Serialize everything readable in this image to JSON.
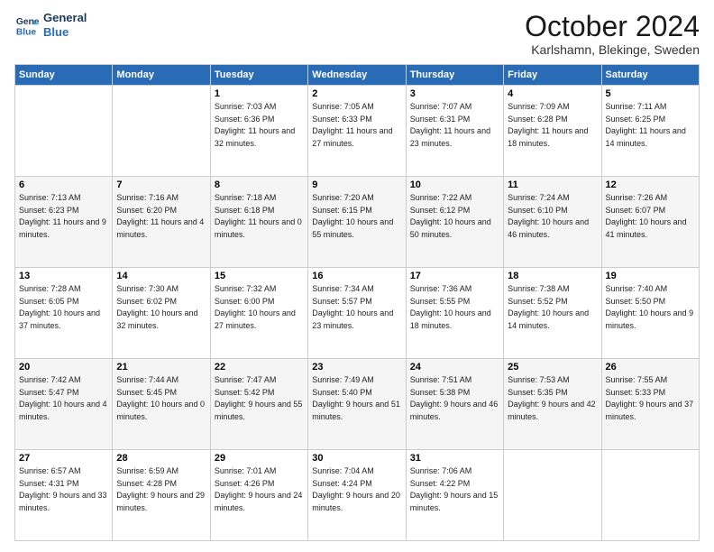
{
  "header": {
    "logo_line1": "General",
    "logo_line2": "Blue",
    "title": "October 2024",
    "subtitle": "Karlshamn, Blekinge, Sweden"
  },
  "days_of_week": [
    "Sunday",
    "Monday",
    "Tuesday",
    "Wednesday",
    "Thursday",
    "Friday",
    "Saturday"
  ],
  "weeks": [
    [
      {
        "day": "",
        "sunrise": "",
        "sunset": "",
        "daylight": ""
      },
      {
        "day": "",
        "sunrise": "",
        "sunset": "",
        "daylight": ""
      },
      {
        "day": "1",
        "sunrise": "Sunrise: 7:03 AM",
        "sunset": "Sunset: 6:36 PM",
        "daylight": "Daylight: 11 hours and 32 minutes."
      },
      {
        "day": "2",
        "sunrise": "Sunrise: 7:05 AM",
        "sunset": "Sunset: 6:33 PM",
        "daylight": "Daylight: 11 hours and 27 minutes."
      },
      {
        "day": "3",
        "sunrise": "Sunrise: 7:07 AM",
        "sunset": "Sunset: 6:31 PM",
        "daylight": "Daylight: 11 hours and 23 minutes."
      },
      {
        "day": "4",
        "sunrise": "Sunrise: 7:09 AM",
        "sunset": "Sunset: 6:28 PM",
        "daylight": "Daylight: 11 hours and 18 minutes."
      },
      {
        "day": "5",
        "sunrise": "Sunrise: 7:11 AM",
        "sunset": "Sunset: 6:25 PM",
        "daylight": "Daylight: 11 hours and 14 minutes."
      }
    ],
    [
      {
        "day": "6",
        "sunrise": "Sunrise: 7:13 AM",
        "sunset": "Sunset: 6:23 PM",
        "daylight": "Daylight: 11 hours and 9 minutes."
      },
      {
        "day": "7",
        "sunrise": "Sunrise: 7:16 AM",
        "sunset": "Sunset: 6:20 PM",
        "daylight": "Daylight: 11 hours and 4 minutes."
      },
      {
        "day": "8",
        "sunrise": "Sunrise: 7:18 AM",
        "sunset": "Sunset: 6:18 PM",
        "daylight": "Daylight: 11 hours and 0 minutes."
      },
      {
        "day": "9",
        "sunrise": "Sunrise: 7:20 AM",
        "sunset": "Sunset: 6:15 PM",
        "daylight": "Daylight: 10 hours and 55 minutes."
      },
      {
        "day": "10",
        "sunrise": "Sunrise: 7:22 AM",
        "sunset": "Sunset: 6:12 PM",
        "daylight": "Daylight: 10 hours and 50 minutes."
      },
      {
        "day": "11",
        "sunrise": "Sunrise: 7:24 AM",
        "sunset": "Sunset: 6:10 PM",
        "daylight": "Daylight: 10 hours and 46 minutes."
      },
      {
        "day": "12",
        "sunrise": "Sunrise: 7:26 AM",
        "sunset": "Sunset: 6:07 PM",
        "daylight": "Daylight: 10 hours and 41 minutes."
      }
    ],
    [
      {
        "day": "13",
        "sunrise": "Sunrise: 7:28 AM",
        "sunset": "Sunset: 6:05 PM",
        "daylight": "Daylight: 10 hours and 37 minutes."
      },
      {
        "day": "14",
        "sunrise": "Sunrise: 7:30 AM",
        "sunset": "Sunset: 6:02 PM",
        "daylight": "Daylight: 10 hours and 32 minutes."
      },
      {
        "day": "15",
        "sunrise": "Sunrise: 7:32 AM",
        "sunset": "Sunset: 6:00 PM",
        "daylight": "Daylight: 10 hours and 27 minutes."
      },
      {
        "day": "16",
        "sunrise": "Sunrise: 7:34 AM",
        "sunset": "Sunset: 5:57 PM",
        "daylight": "Daylight: 10 hours and 23 minutes."
      },
      {
        "day": "17",
        "sunrise": "Sunrise: 7:36 AM",
        "sunset": "Sunset: 5:55 PM",
        "daylight": "Daylight: 10 hours and 18 minutes."
      },
      {
        "day": "18",
        "sunrise": "Sunrise: 7:38 AM",
        "sunset": "Sunset: 5:52 PM",
        "daylight": "Daylight: 10 hours and 14 minutes."
      },
      {
        "day": "19",
        "sunrise": "Sunrise: 7:40 AM",
        "sunset": "Sunset: 5:50 PM",
        "daylight": "Daylight: 10 hours and 9 minutes."
      }
    ],
    [
      {
        "day": "20",
        "sunrise": "Sunrise: 7:42 AM",
        "sunset": "Sunset: 5:47 PM",
        "daylight": "Daylight: 10 hours and 4 minutes."
      },
      {
        "day": "21",
        "sunrise": "Sunrise: 7:44 AM",
        "sunset": "Sunset: 5:45 PM",
        "daylight": "Daylight: 10 hours and 0 minutes."
      },
      {
        "day": "22",
        "sunrise": "Sunrise: 7:47 AM",
        "sunset": "Sunset: 5:42 PM",
        "daylight": "Daylight: 9 hours and 55 minutes."
      },
      {
        "day": "23",
        "sunrise": "Sunrise: 7:49 AM",
        "sunset": "Sunset: 5:40 PM",
        "daylight": "Daylight: 9 hours and 51 minutes."
      },
      {
        "day": "24",
        "sunrise": "Sunrise: 7:51 AM",
        "sunset": "Sunset: 5:38 PM",
        "daylight": "Daylight: 9 hours and 46 minutes."
      },
      {
        "day": "25",
        "sunrise": "Sunrise: 7:53 AM",
        "sunset": "Sunset: 5:35 PM",
        "daylight": "Daylight: 9 hours and 42 minutes."
      },
      {
        "day": "26",
        "sunrise": "Sunrise: 7:55 AM",
        "sunset": "Sunset: 5:33 PM",
        "daylight": "Daylight: 9 hours and 37 minutes."
      }
    ],
    [
      {
        "day": "27",
        "sunrise": "Sunrise: 6:57 AM",
        "sunset": "Sunset: 4:31 PM",
        "daylight": "Daylight: 9 hours and 33 minutes."
      },
      {
        "day": "28",
        "sunrise": "Sunrise: 6:59 AM",
        "sunset": "Sunset: 4:28 PM",
        "daylight": "Daylight: 9 hours and 29 minutes."
      },
      {
        "day": "29",
        "sunrise": "Sunrise: 7:01 AM",
        "sunset": "Sunset: 4:26 PM",
        "daylight": "Daylight: 9 hours and 24 minutes."
      },
      {
        "day": "30",
        "sunrise": "Sunrise: 7:04 AM",
        "sunset": "Sunset: 4:24 PM",
        "daylight": "Daylight: 9 hours and 20 minutes."
      },
      {
        "day": "31",
        "sunrise": "Sunrise: 7:06 AM",
        "sunset": "Sunset: 4:22 PM",
        "daylight": "Daylight: 9 hours and 15 minutes."
      },
      {
        "day": "",
        "sunrise": "",
        "sunset": "",
        "daylight": ""
      },
      {
        "day": "",
        "sunrise": "",
        "sunset": "",
        "daylight": ""
      }
    ]
  ]
}
